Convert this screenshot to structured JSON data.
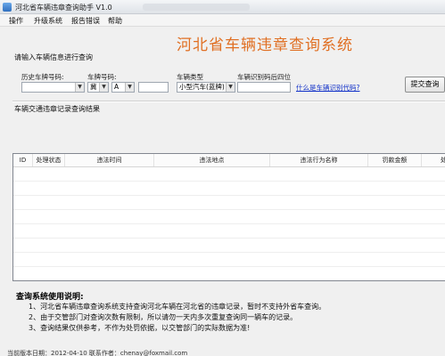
{
  "window": {
    "title": "河北省车辆违章查询助手 V1.0"
  },
  "menu": {
    "items": [
      "操作",
      "升级系统",
      "报告错误",
      "帮助"
    ]
  },
  "banner": {
    "title": "河北省车辆违章查询系统"
  },
  "form": {
    "section_title": "请输入车辆信息进行查询",
    "history_label": "历史车牌号码:",
    "history_value": "",
    "plate_label": "车牌号码:",
    "plate_province": "冀",
    "plate_letter": "A",
    "plate_number": "",
    "type_label": "车辆类型",
    "type_value": "小型汽车(蓝牌)",
    "vin_label": "车辆识别码后四位",
    "vin_value": "",
    "vin_help_link": "什么是车辆识别代码?",
    "submit_label": "提交查询"
  },
  "results": {
    "section_title": "车辆交通违章记录查询结果",
    "columns": [
      "ID",
      "处理状态",
      "违法时间",
      "违法地点",
      "违法行为名称",
      "罚款金额",
      "处"
    ],
    "rows": []
  },
  "notes": {
    "title": "查询系统使用说明:",
    "lines": [
      "1、河北省车辆违章查询系统支持查询河北车辆在河北省的违章记录，暂时不支持外省车查询。",
      "2、由于交管部门对查询次数有限制，所以请勿一天内多次重复查询同一辆车的记录。",
      "3、查询结果仅供参考，不作为处罚依据，以交管部门的实际数据为准!"
    ]
  },
  "status_bar": {
    "text": "当前版本日期：2012-04-10   联系作者：chenay@foxmail.com"
  }
}
